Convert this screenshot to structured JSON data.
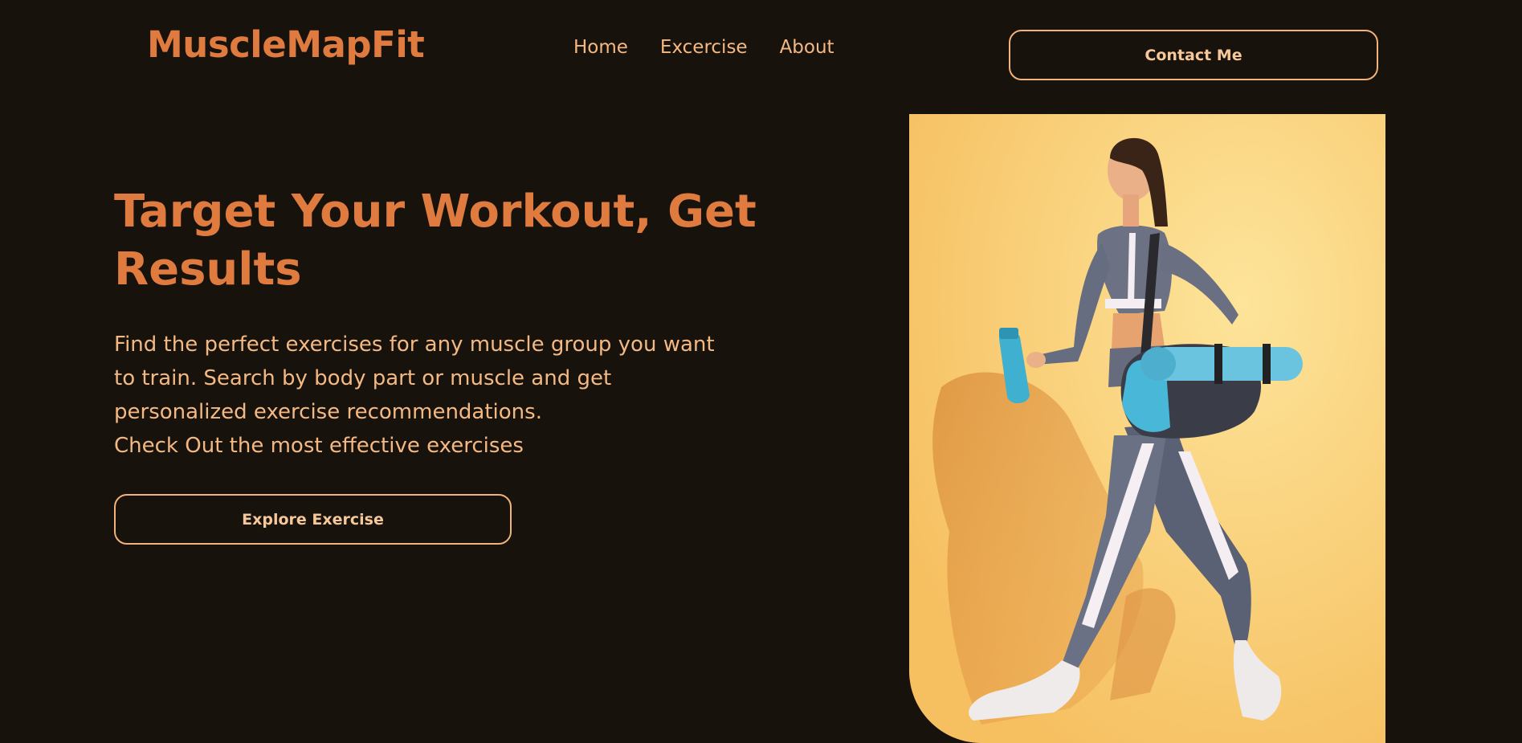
{
  "header": {
    "brand": "MuscleMapFit",
    "nav": [
      {
        "label": "Home"
      },
      {
        "label": "Excercise"
      },
      {
        "label": "About"
      }
    ],
    "contact_label": "Contact Me"
  },
  "hero": {
    "title": "Target Your Workout, Get Results",
    "description_line1": "Find the perfect exercises for any muscle group you want to train. Search by body part or muscle and get personalized exercise recommendations.",
    "description_line2": "Check Out the most effective exercises",
    "cta_label": "Explore Exercise"
  },
  "colors": {
    "background": "#17120c",
    "accent": "#e07b3f",
    "text": "#f4b982",
    "button_border": "#f1b37a",
    "image_background": "#f8cb6c"
  },
  "icons": {
    "hero_image": "woman-walking-with-gym-bag-and-water-bottle-illustration"
  }
}
